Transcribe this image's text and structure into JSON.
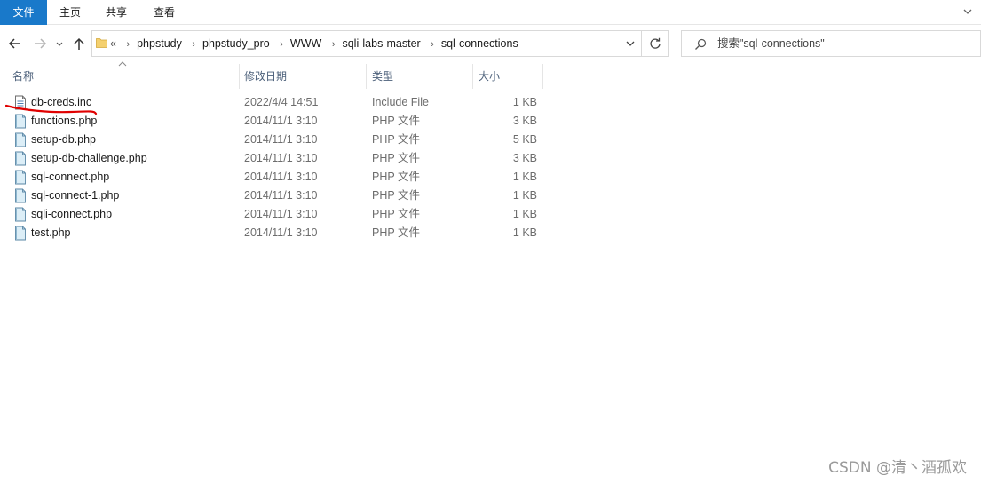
{
  "ribbon": {
    "tabs": [
      "文件",
      "主页",
      "共享",
      "查看"
    ]
  },
  "address": {
    "overflow": "«",
    "crumbs": [
      "phpstudy",
      "phpstudy_pro",
      "WWW",
      "sqli-labs-master",
      "sql-connections"
    ]
  },
  "search": {
    "placeholder": "搜索\"sql-connections\""
  },
  "columns": {
    "name": "名称",
    "date": "修改日期",
    "type": "类型",
    "size": "大小"
  },
  "files": [
    {
      "name": "db-creds.inc",
      "date": "2022/4/4 14:51",
      "type": "Include File",
      "size": "1 KB",
      "icon": "inc-file-icon"
    },
    {
      "name": "functions.php",
      "date": "2014/11/1 3:10",
      "type": "PHP 文件",
      "size": "3 KB",
      "icon": "php-file-icon"
    },
    {
      "name": "setup-db.php",
      "date": "2014/11/1 3:10",
      "type": "PHP 文件",
      "size": "5 KB",
      "icon": "php-file-icon"
    },
    {
      "name": "setup-db-challenge.php",
      "date": "2014/11/1 3:10",
      "type": "PHP 文件",
      "size": "3 KB",
      "icon": "php-file-icon"
    },
    {
      "name": "sql-connect.php",
      "date": "2014/11/1 3:10",
      "type": "PHP 文件",
      "size": "1 KB",
      "icon": "php-file-icon"
    },
    {
      "name": "sql-connect-1.php",
      "date": "2014/11/1 3:10",
      "type": "PHP 文件",
      "size": "1 KB",
      "icon": "php-file-icon"
    },
    {
      "name": "sqli-connect.php",
      "date": "2014/11/1 3:10",
      "type": "PHP 文件",
      "size": "1 KB",
      "icon": "php-file-icon"
    },
    {
      "name": "test.php",
      "date": "2014/11/1 3:10",
      "type": "PHP 文件",
      "size": "1 KB",
      "icon": "php-file-icon"
    }
  ],
  "watermark": "CSDN @清丶酒孤欢",
  "colors": {
    "accent": "#1979ca",
    "annotation": "#e00000"
  }
}
